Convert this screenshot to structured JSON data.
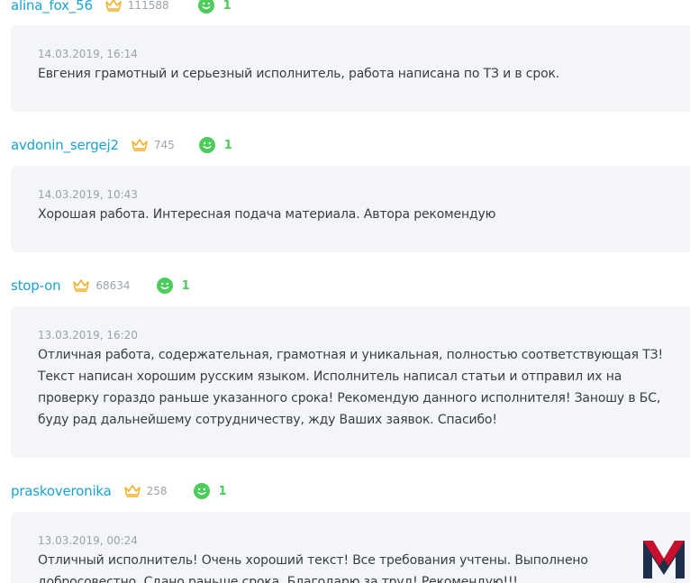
{
  "reviews": [
    {
      "username": "alina_fox_56",
      "rating": "111588",
      "likes": "1",
      "date": "14.03.2019, 16:14",
      "text": "Евгения грамотный и серьезный исполнитель, работа написана по ТЗ и в срок."
    },
    {
      "username": "avdonin_sergej2",
      "rating": "745",
      "likes": "1",
      "date": "14.03.2019, 10:43",
      "text": "Хорошая работа. Интересная подача материала. Автора рекомендую"
    },
    {
      "username": "stop-on",
      "rating": "68634",
      "likes": "1",
      "date": "13.03.2019, 16:20",
      "text": "Отличная работа, содержательная, грамотная и уникальная, полностью соответствующая ТЗ! Текст написан хорошим русским языком. Исполнитель написал статьи и отправил их на проверку гораздо раньше указанного срока! Рекомендую данного исполнителя! Заношу в БС, буду рад дальнейшему сотрудничеству, жду Ваших заявок. Спасибо!"
    },
    {
      "username": "praskoveronika",
      "rating": "258",
      "likes": "1",
      "date": "13.03.2019, 00:24",
      "text": "Отличный исполнитель! Очень хороший текст! Все требования учтены. Выполнено добросовестно. Сдано раньше срока. Благодарю за труд! Рекомендую!!!"
    }
  ],
  "icons": {
    "rating": "crown-icon",
    "likes": "smile-icon",
    "watermark": "m-logo"
  },
  "colors": {
    "username": "#1aa3cf",
    "crown": "#f2b230",
    "smile": "#4ccc5b",
    "card_bg": "#f3f5f8",
    "logo_red": "#c8102e",
    "logo_blue": "#1f2f4a"
  }
}
